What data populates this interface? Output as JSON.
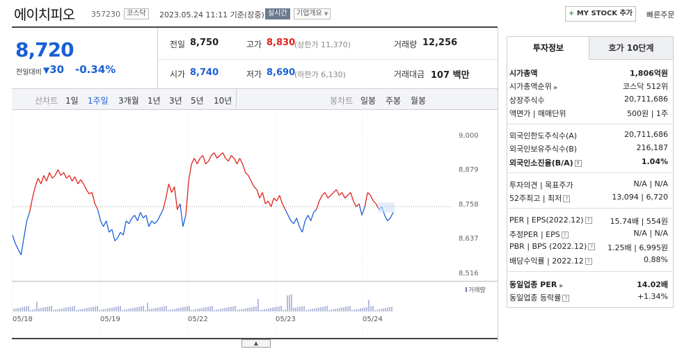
{
  "header": {
    "name": "에이치피오",
    "code": "357230",
    "market": "코스닥",
    "datetime": "2023.05.24 11:11 기준(장중)",
    "live_label": "실시간",
    "corp_label": "기업개요",
    "mystock_label": "MY STOCK 추가",
    "quick_label": "빠른주문"
  },
  "quote": {
    "price": "8,720",
    "change_label": "전일대비",
    "change": "30",
    "change_pct": "-0.34%",
    "prev_label": "전일",
    "prev": "8,750",
    "open_label": "시가",
    "open": "8,740",
    "high_label": "고가",
    "high": "8,830",
    "upper_limit": "(상한가 11,370)",
    "low_label": "저가",
    "low": "8,690",
    "lower_limit": "(하한가 6,130)",
    "volume_label": "거래량",
    "volume": "12,256",
    "amount_label": "거래대금",
    "amount": "107 백만"
  },
  "periods": {
    "label": "선차트",
    "items": [
      "1일",
      "1주일",
      "3개월",
      "1년",
      "3년",
      "5년",
      "10년"
    ],
    "selected": "1주일"
  },
  "candle": {
    "label": "봉차트",
    "items": [
      "일봉",
      "주봉",
      "월봉"
    ]
  },
  "chart_data": {
    "type": "line",
    "y_ticks": [
      "9,000",
      "8,879",
      "8,758",
      "8,637",
      "8,516"
    ],
    "ylim": [
      8516,
      9000
    ],
    "x_ticks": [
      "05/18",
      "05/19",
      "05/22",
      "05/23",
      "05/24"
    ],
    "prev_close": 8750,
    "up_color": "#e0201b",
    "down_color": "#1a5fd6",
    "volume_label": "거래량",
    "series": [
      {
        "values": [
          8650,
          8620,
          8600,
          8580,
          8640,
          8700,
          8730,
          8780,
          8820,
          8850,
          8830,
          8860,
          8840,
          8870,
          8850,
          8860,
          8880,
          8860,
          8870,
          8850,
          8860,
          8840,
          8855,
          8830,
          8845,
          8830,
          8810,
          8795,
          8800,
          8760,
          8740,
          8700,
          8680,
          8700,
          8660,
          8670,
          8630,
          8640,
          8660,
          8650,
          8700,
          8690,
          8710,
          8720,
          8700,
          8730,
          8710,
          8720,
          8680,
          8700,
          8690,
          8700,
          8720,
          8740,
          8780,
          8830,
          8800,
          8820,
          8740,
          8760,
          8680,
          8720,
          8840,
          8900,
          8920,
          8900,
          8920,
          8930,
          8900,
          8910,
          8930,
          8940,
          8920,
          8930,
          8940,
          8920,
          8910,
          8930,
          8920,
          8900,
          8920,
          8900,
          8870,
          8860,
          8840,
          8820,
          8810,
          8780,
          8800,
          8760,
          8770,
          8750,
          8780,
          8770,
          8790,
          8760,
          8740,
          8720,
          8700,
          8690,
          8710,
          8680,
          8660,
          8700,
          8720,
          8700,
          8730,
          8740,
          8770,
          8790,
          8800,
          8780,
          8790,
          8800,
          8810,
          8790,
          8800,
          8780,
          8790,
          8800,
          8770,
          8750,
          8760,
          8720,
          8750,
          8800,
          8790,
          8770,
          8760,
          8740,
          8750,
          8720,
          8700,
          8710,
          8730
        ]
      }
    ]
  },
  "panel": {
    "tab1": "투자정보",
    "tab2": "호가 10단계",
    "rows": [
      {
        "label": "시가총액",
        "value": "1,806억원"
      },
      {
        "label": "시가총액순위",
        "value": "코스닥 512위"
      },
      {
        "label": "상장주식수",
        "value": "20,711,686"
      },
      {
        "label": "액면가 | 매매단위",
        "value": "500원 | 1주"
      },
      {
        "label": "외국인한도주식수(A)",
        "value": "20,711,686"
      },
      {
        "label": "외국인보유주식수(B)",
        "value": "216,187"
      },
      {
        "label": "외국인소진율(B/A)",
        "value": "1.04%"
      },
      {
        "label": "투자의견 | 목표주가",
        "value": "N/A | N/A"
      },
      {
        "label": "52주최고 | 최저",
        "value": "13,094 | 6,720"
      },
      {
        "label": "PER | EPS(2022.12)",
        "value": "15.74배 | 554원"
      },
      {
        "label": "추정PER | EPS",
        "value": "N/A | N/A"
      },
      {
        "label": "PBR | BPS (2022.12)",
        "value": "1.25배 | 6,995원"
      },
      {
        "label": "배당수익률 | 2022.12",
        "value": "0.88%"
      },
      {
        "label": "동일업종 PER",
        "value": "14.02배"
      },
      {
        "label": "동일업종 등락률",
        "value": "+1.34%"
      }
    ]
  }
}
